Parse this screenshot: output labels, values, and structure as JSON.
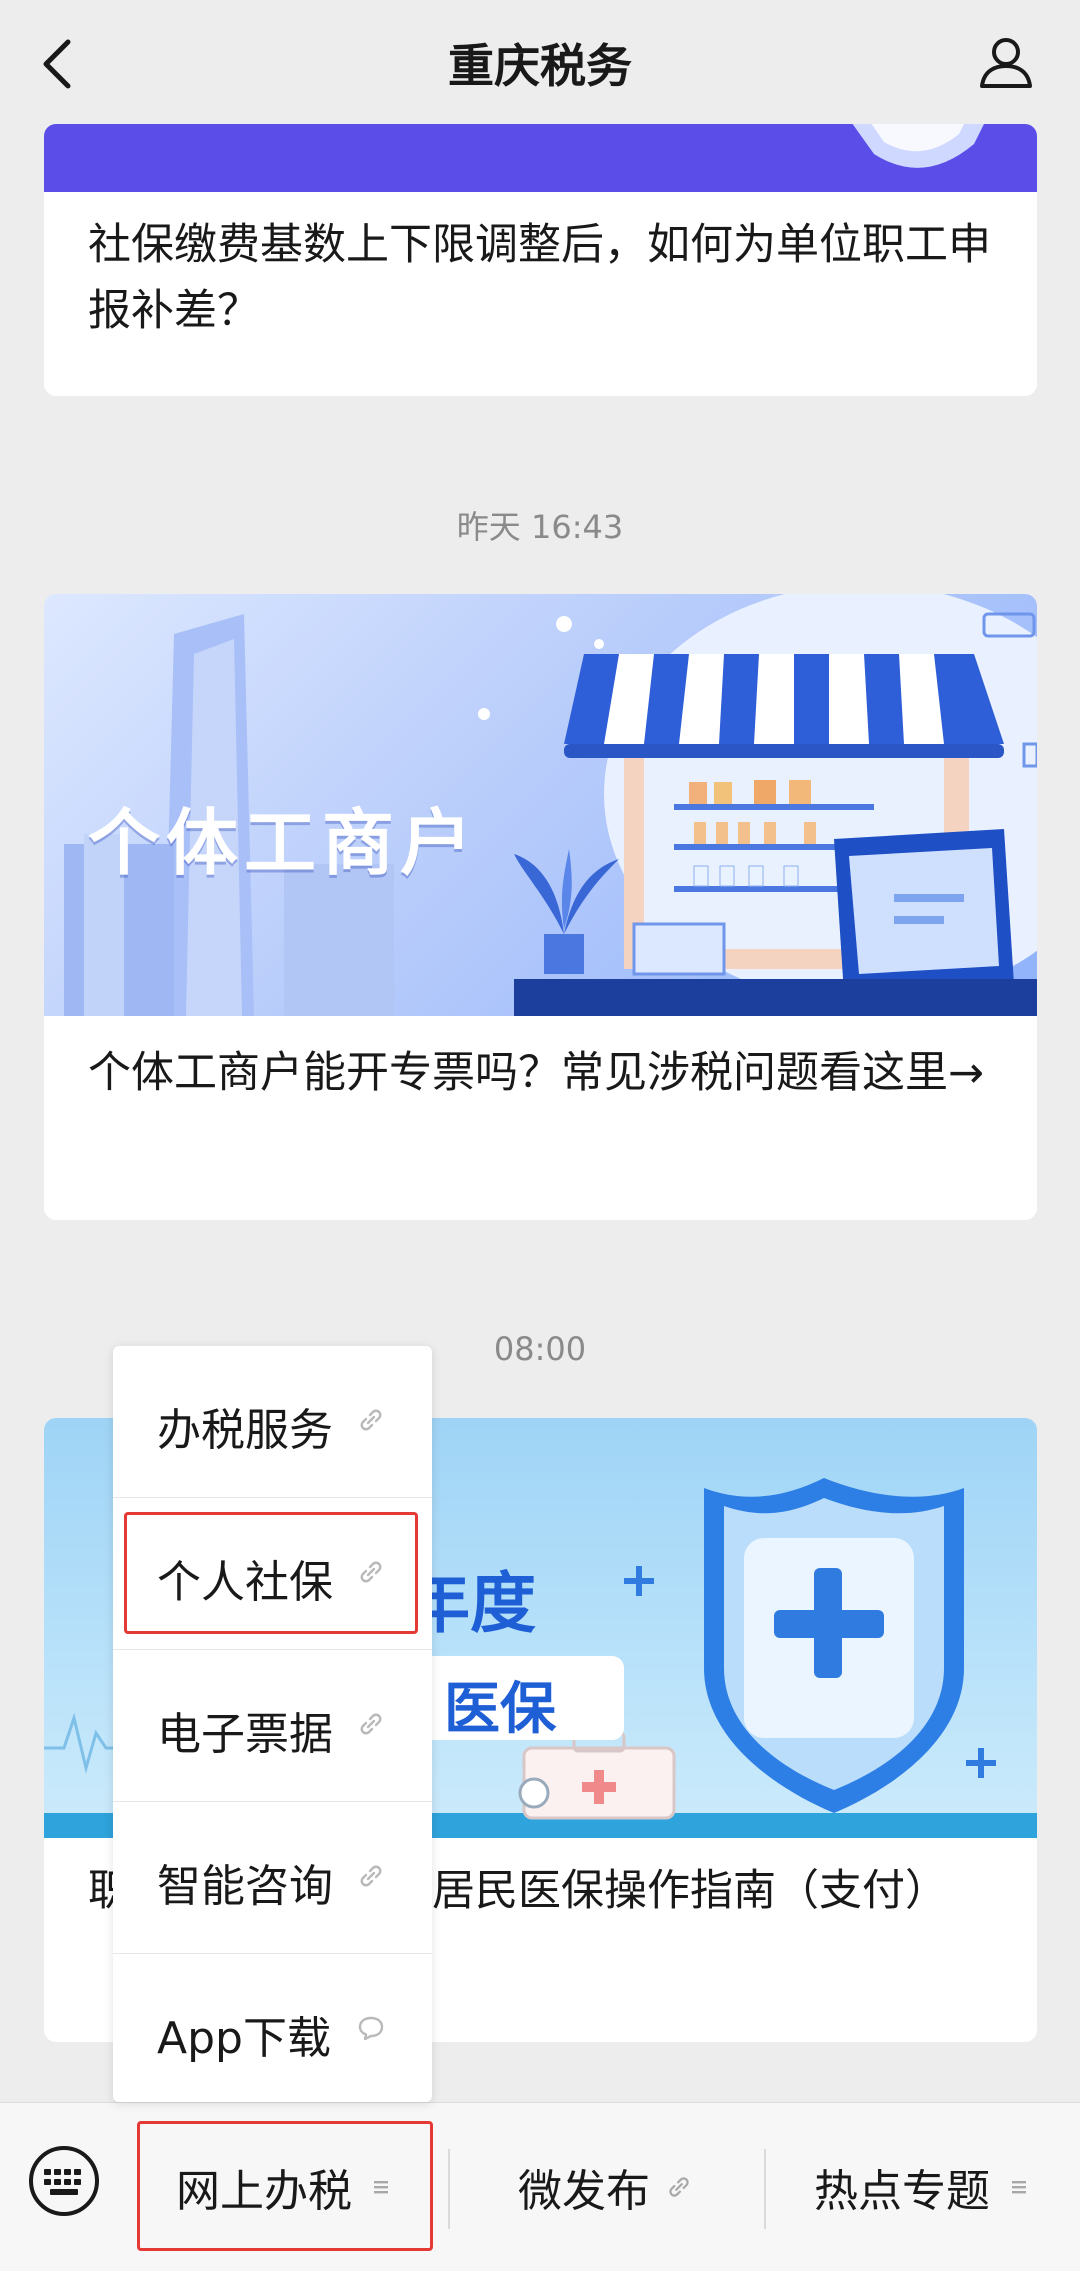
{
  "header": {
    "title": "重庆税务"
  },
  "messages": [
    {
      "title": "社保缴费基数上下限调整后，如何为单位职工申报补差？"
    },
    {
      "time": "昨天 16:43",
      "banner_text": "个体工商户",
      "title": "个体工商户能开专票吗？常见涉税问题看这里→"
    },
    {
      "time": "08:00",
      "banner_text_1": "年度",
      "banner_text_2": "医保",
      "title": "职工为家庭中代缴居民医保操作指南（支付）"
    }
  ],
  "popup_menu": {
    "items": [
      {
        "label": "办税服务",
        "icon": "link-icon"
      },
      {
        "label": "个人社保",
        "icon": "link-icon",
        "selected": true
      },
      {
        "label": "电子票据",
        "icon": "link-icon"
      },
      {
        "label": "智能咨询",
        "icon": "link-icon"
      },
      {
        "label": "App下载",
        "icon": "chat-bubble-icon"
      }
    ]
  },
  "bottom_menu": {
    "items": [
      {
        "label": "网上办税",
        "icon": "menu-lines-icon",
        "selected": true
      },
      {
        "label": "微发布",
        "icon": "link-icon"
      },
      {
        "label": "热点专题",
        "icon": "menu-lines-icon"
      }
    ]
  },
  "colors": {
    "accent_red": "#e53935",
    "banner_purple": "#5a4de8"
  }
}
